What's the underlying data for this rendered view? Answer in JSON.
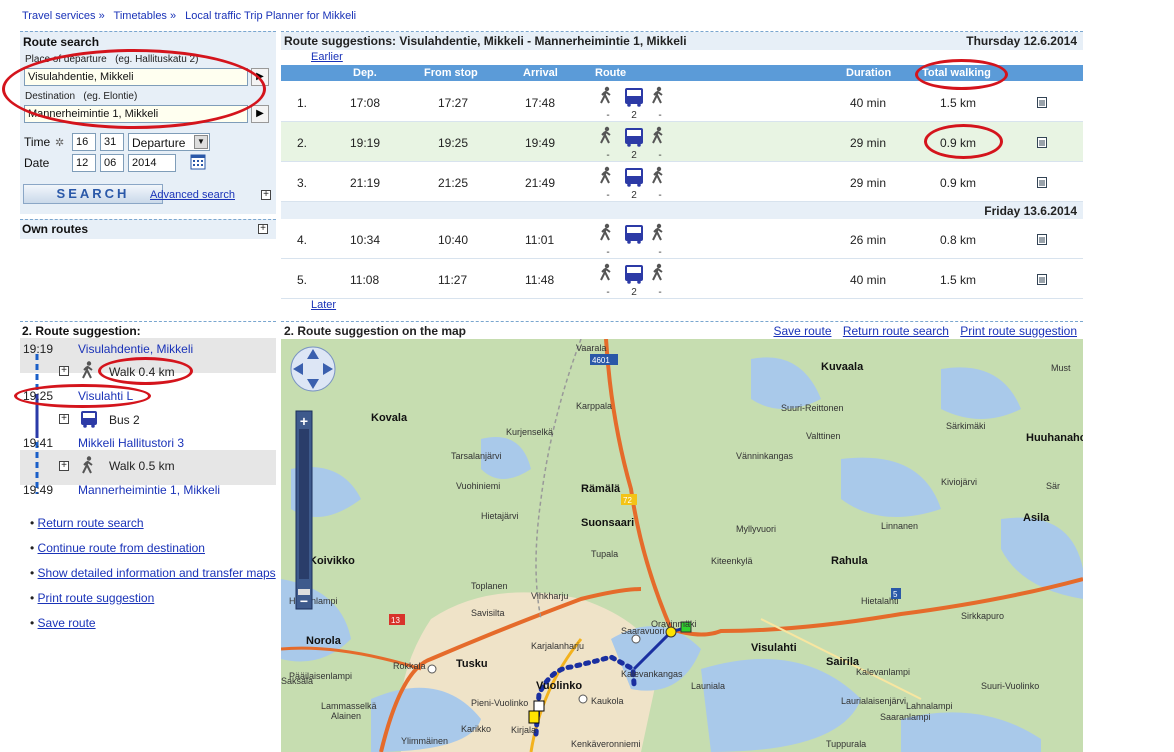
{
  "breadcrumb": [
    "Travel services",
    "Timetables",
    "Local traffic Trip Planner for Mikkeli"
  ],
  "search": {
    "title": "Route search",
    "departure_label": "Place of departure",
    "departure_hint": "(eg. Hallituskatu 2)",
    "departure_value": "Visulahdentie, Mikkeli",
    "destination_label": "Destination",
    "destination_hint": "(eg. Elontie)",
    "destination_value": "Mannerheimintie 1, Mikkeli",
    "time_label": "Time",
    "hour": "16",
    "minute": "31",
    "time_mode": "Departure",
    "date_label": "Date",
    "day": "12",
    "month": "06",
    "year": "2014",
    "search_button": "SEARCH",
    "advanced_link": "Advanced search"
  },
  "own_routes": "Own routes",
  "results": {
    "title": "Route suggestions: Visulahdentie, Mikkeli - Mannerheimintie 1, Mikkeli",
    "date1": "Thursday 12.6.2014",
    "date2": "Friday 13.6.2014",
    "earlier": "Earlier",
    "later": "Later",
    "columns": {
      "dep": "Dep.",
      "from_stop": "From stop",
      "arrival": "Arrival",
      "route": "Route",
      "duration": "Duration",
      "walking": "Total walking"
    },
    "rows": [
      {
        "n": "1.",
        "dep": "17:08",
        "from": "17:27",
        "arr": "17:48",
        "line": "2",
        "dur": "40 min",
        "walk": "1.5 km"
      },
      {
        "n": "2.",
        "dep": "19:19",
        "from": "19:25",
        "arr": "19:49",
        "line": "2",
        "dur": "29 min",
        "walk": "0.9 km"
      },
      {
        "n": "3.",
        "dep": "21:19",
        "from": "21:25",
        "arr": "21:49",
        "line": "2",
        "dur": "29 min",
        "walk": "0.9 km"
      },
      {
        "n": "4.",
        "dep": "10:34",
        "from": "10:40",
        "arr": "11:01",
        "line": "",
        "dur": "26 min",
        "walk": "0.8 km"
      },
      {
        "n": "5.",
        "dep": "11:08",
        "from": "11:27",
        "arr": "11:48",
        "line": "2",
        "dur": "40 min",
        "walk": "1.5 km"
      }
    ],
    "dash": "-"
  },
  "suggestion": {
    "title": "2. Route suggestion:",
    "legs": [
      {
        "time": "19:19",
        "stop": "Visulahdentie, Mikkeli"
      },
      {
        "mode": "Walk 0.4 km"
      },
      {
        "time": "19:25",
        "stop": "Visulahti L"
      },
      {
        "mode": "Bus 2"
      },
      {
        "time": "19:41",
        "stop": "Mikkeli Hallitustori 3"
      },
      {
        "mode": "Walk 0.5 km"
      },
      {
        "time": "19:49",
        "stop": "Mannerheimintie 1, Mikkeli"
      }
    ]
  },
  "links": [
    "Return route search",
    "Continue route from destination",
    "Show detailed information and transfer maps",
    "Print route suggestion",
    "Save route"
  ],
  "map": {
    "title": "2. Route suggestion on the map",
    "save": "Save route",
    "return": "Return route search",
    "print": "Print route suggestion",
    "labels": [
      "Vaarala",
      "Kuvaala",
      "Must",
      "Kovala",
      "Karppala",
      "Suuri-Reittonen",
      "Särkimäki",
      "Huuhanaho",
      "Kurjenselkä",
      "Valttinen",
      "Tarsalanjärvi",
      "Vänninkangas",
      "Sär",
      "Vuohiniemi",
      "Kiviojärvi",
      "Rämälä",
      "Asila",
      "Suonsaari",
      "Hietajärvi",
      "Myllyvuori",
      "Linnanen",
      "Rahula",
      "Koivikko",
      "Tupala",
      "Kiteenkylä",
      "Toplanen",
      "Vihkharju",
      "Savisilta",
      "Sirkkapuro",
      "Hietalahti",
      "Hertunlampi",
      "Saaravuori",
      "Oravinmäki",
      "Visulahti",
      "Norola",
      "Karjalanharju",
      "Rokkala",
      "Tusku",
      "Kalevankangas",
      "Launiala",
      "Sairila",
      "Kalevanlampi",
      "Pääilaisenlampi",
      "Vuolinko",
      "Saksala",
      "Pieni-Vuolinko",
      "Kaukola",
      "Laurialaisenjärvi",
      "Lahnalampi",
      "Ylimmäinen",
      "Karikko",
      "Kirjala",
      "Kenkäveronniemi",
      "Tuppurala",
      "Lammasselkä",
      "Alainen",
      "Suuri-Vuolinko",
      "Saaranlampi"
    ],
    "road_numbers": [
      "4601",
      "72",
      "13",
      "5"
    ]
  }
}
